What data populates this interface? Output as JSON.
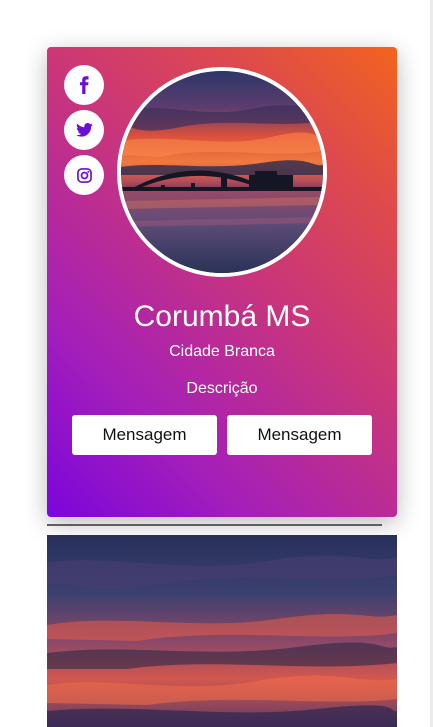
{
  "profile": {
    "name": "Corumbá MS",
    "subtitle": "Cidade Branca",
    "description": "Descrição",
    "avatar_alt": "sunset-bridge-photo"
  },
  "social": [
    {
      "icon": "facebook-icon",
      "glyph": "f"
    },
    {
      "icon": "twitter-icon"
    },
    {
      "icon": "instagram-icon"
    }
  ],
  "actions": {
    "button_1": "Mensagem",
    "button_2": "Mensagem"
  },
  "colors": {
    "gradient_start": "#7b05dc",
    "gradient_end": "#f2641e",
    "icon_color": "#6a0fd6",
    "button_bg": "#ffffff"
  }
}
